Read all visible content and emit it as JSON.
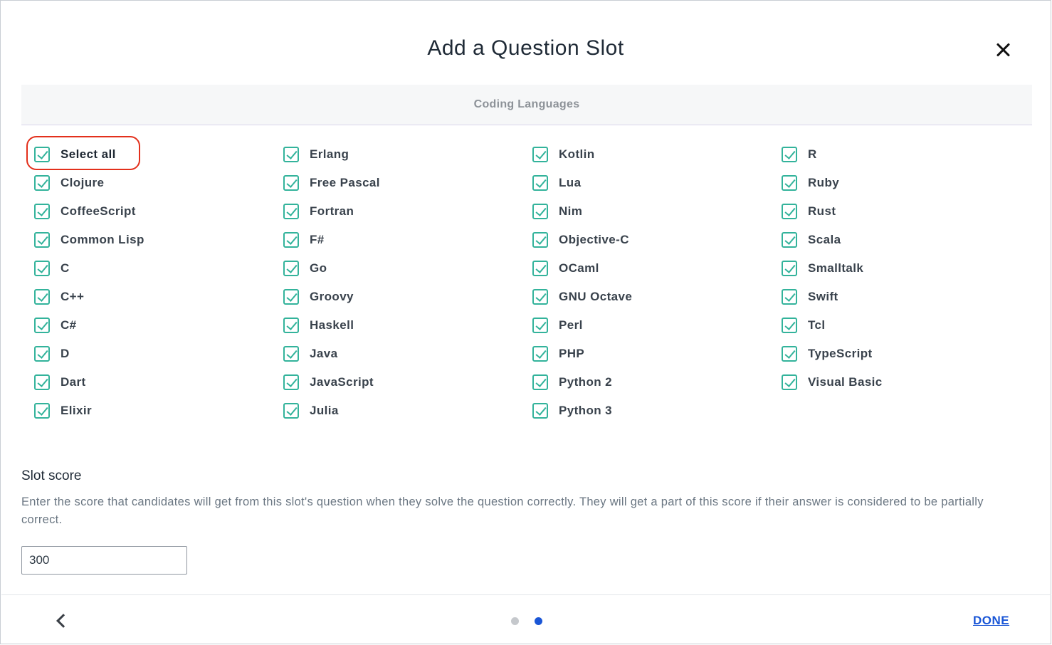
{
  "modal": {
    "title": "Add a Question Slot",
    "close_icon": "close-icon"
  },
  "section": {
    "header": "Coding Languages"
  },
  "languages": {
    "col1": [
      "Select all",
      "Clojure",
      "CoffeeScript",
      "Common Lisp",
      "C",
      "C++",
      "C#",
      "D",
      "Dart",
      "Elixir"
    ],
    "col2": [
      "Erlang",
      "Free Pascal",
      "Fortran",
      "F#",
      "Go",
      "Groovy",
      "Haskell",
      "Java",
      "JavaScript",
      "Julia"
    ],
    "col3": [
      "Kotlin",
      "Lua",
      "Nim",
      "Objective-C",
      "OCaml",
      "GNU Octave",
      "Perl",
      "PHP",
      "Python 2",
      "Python 3"
    ],
    "col4": [
      "R",
      "Ruby",
      "Rust",
      "Scala",
      "Smalltalk",
      "Swift",
      "Tcl",
      "TypeScript",
      "Visual Basic"
    ],
    "all_checked": true
  },
  "slot": {
    "title": "Slot score",
    "description": "Enter the score that candidates will get from this slot's question when they solve the question correctly. They will get a part of this score if their answer is considered to be partially correct.",
    "score_value": "300"
  },
  "footer": {
    "back_icon": "chevron-left-icon",
    "pagination": {
      "pages": 2,
      "current": 2
    },
    "done_label": "DONE"
  },
  "colors": {
    "checkbox": "#33b39b",
    "accent": "#1a56d6",
    "highlight": "#e3301c"
  }
}
